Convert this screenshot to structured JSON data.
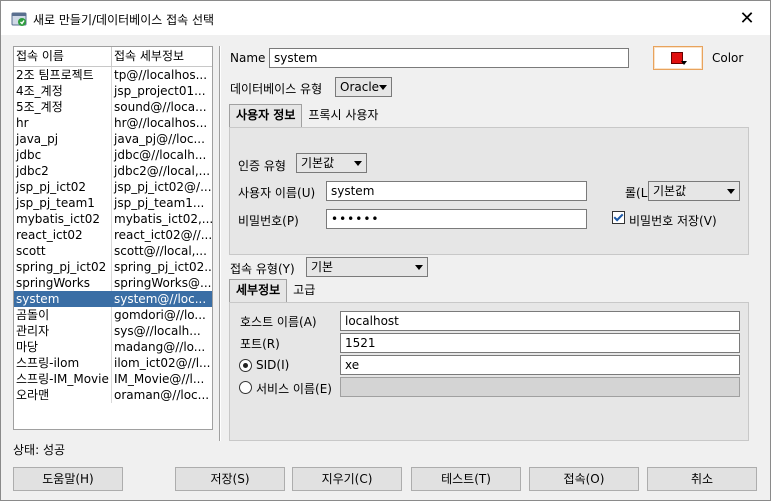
{
  "window": {
    "title": "새로 만들기/데이터베이스 접속 선택",
    "close_glyph": "✕"
  },
  "connections": {
    "headers": [
      "접속 이름",
      "접속 세부정보"
    ],
    "rows": [
      [
        "2조 팀프로젝트",
        "tp@//localhos..."
      ],
      [
        "4조_계정",
        "jsp_project01..."
      ],
      [
        "5조_계정",
        "sound@//loca..."
      ],
      [
        "hr",
        "hr@//localhos..."
      ],
      [
        "java_pj",
        "java_pj@//loc..."
      ],
      [
        "jdbc",
        "jdbc@//localh..."
      ],
      [
        "jdbc2",
        "jdbc2@//local,..."
      ],
      [
        "jsp_pj_ict02",
        "jsp_pj_ict02@/..."
      ],
      [
        "jsp_pj_team1",
        "jsp_pj_team1..."
      ],
      [
        "mybatis_ict02",
        "mybatis_ict02,..."
      ],
      [
        "react_ict02",
        "react_ict02@//..."
      ],
      [
        "scott",
        "scott@//local,..."
      ],
      [
        "spring_pj_ict02",
        "spring_pj_ict02..."
      ],
      [
        "springWorks",
        "springWorks@..."
      ],
      [
        "system",
        "system@//loc..."
      ],
      [
        "곰돌이",
        "gomdori@//lo..."
      ],
      [
        "관리자",
        "sys@//localh..."
      ],
      [
        "마당",
        "madang@//lo..."
      ],
      [
        "스프링-ilom",
        "ilom_ict02@//l..."
      ],
      [
        "스프링-IM_Movie",
        "IM_Movie@//l..."
      ],
      [
        "오라맨",
        "oraman@//loc..."
      ]
    ],
    "selected_index": 14
  },
  "status": "상태: 성공",
  "form": {
    "name_label": "Name",
    "name_value": "system",
    "color_label": "Color",
    "color_value": "#e01010",
    "db_type_label": "데이터베이스 유형",
    "db_type_value": "Oracle",
    "user_tabs": [
      "사용자 정보",
      "프록시 사용자"
    ],
    "auth_type_label": "인증 유형",
    "auth_type_value": "기본값",
    "username_label": "사용자 이름(U)",
    "username_value": "system",
    "role_label": "롤(L)",
    "role_value": "기본값",
    "password_label": "비밀번호(P)",
    "password_value": "••••••",
    "save_password_label": "비밀번호 저장(V)",
    "save_password_checked": true,
    "conn_type_label": "접속 유형(Y)",
    "conn_type_value": "기본",
    "detail_tabs": [
      "세부정보",
      "고급"
    ],
    "hostname_label": "호스트 이름(A)",
    "hostname_value": "localhost",
    "port_label": "포트(R)",
    "port_value": "1521",
    "sid_label": "SID(I)",
    "sid_value": "xe",
    "service_label": "서비스 이름(E)",
    "service_value": ""
  },
  "buttons": {
    "help": "도움말(H)",
    "save": "저장(S)",
    "clear": "지우기(C)",
    "test": "테스트(T)",
    "connect": "접속(O)",
    "cancel": "취소"
  }
}
